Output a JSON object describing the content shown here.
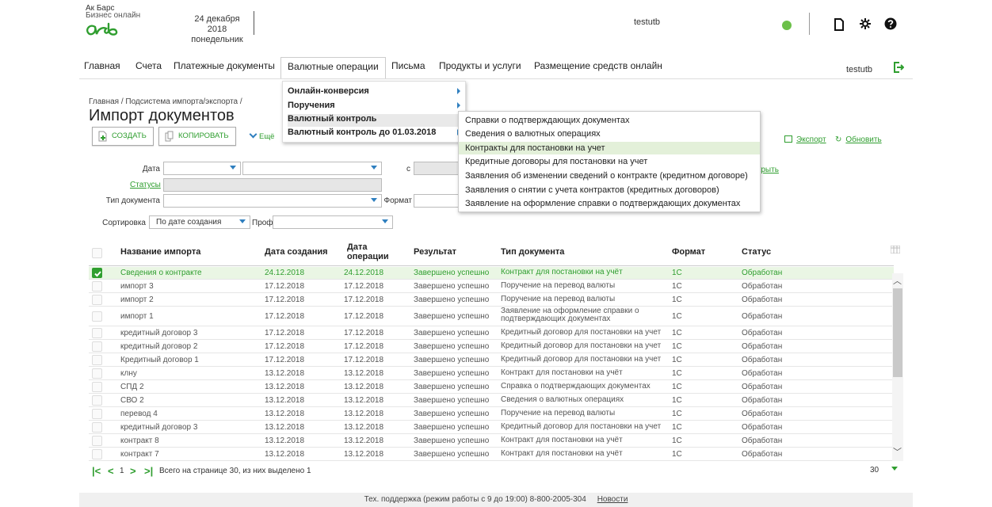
{
  "header": {
    "bank_line1": "Ак Барс",
    "bank_line2": "Бизнес онлайн",
    "date": "24 декабря 2018",
    "weekday": "понедельник",
    "user": "testutb",
    "status_color": "#6cc04a"
  },
  "nav": {
    "items": [
      "Главная",
      "Счета",
      "Платежные документы",
      "Валютные операции",
      "Письма",
      "Продукты и услуги",
      "Размещение средств онлайн"
    ],
    "user": "testutb"
  },
  "page": {
    "breadcrumb": "Главная / Подсистема импорта/экспорта /",
    "title": "Импорт документов",
    "create_label": "СОЗДАТЬ",
    "copy_label": "КОПИРОВАТЬ",
    "more_label": "Ещё",
    "export_label": "Экспорт",
    "refresh_label": "Обновить",
    "hide_label": "крыть"
  },
  "filters": {
    "date_label": "Дата",
    "from_label": "с",
    "statuses_label": "Статусы",
    "doc_type_label": "Тип документа",
    "format_label": "Формат",
    "sort_label": "Сортировка",
    "sort_value": "По дате создания",
    "profile_label": "Профиль"
  },
  "menu": {
    "items": [
      "Онлайн-конверсия",
      "Поручения",
      "Валютный контроль",
      "Валютный контроль до 01.03.2018"
    ],
    "submenu": [
      "Справки о подтверждающих документах",
      "Сведения о валютных операциях",
      "Контракты для постановки на учет",
      "Кредитные договоры для постановки на учет",
      "Заявления об изменении сведений о контракте (кредитном договоре)",
      "Заявления о снятии с учета контрактов (кредитных договоров)",
      "Заявление на оформление справки о подтверждающих документах"
    ]
  },
  "table": {
    "headers": {
      "name": "Название импорта",
      "created": "Дата создания",
      "op_date_1": "Дата",
      "op_date_2": "операции",
      "result": "Результат",
      "doc_type": "Тип документа",
      "format": "Формат",
      "status": "Статус"
    },
    "rows": [
      {
        "name": "Сведения о контракте",
        "created": "24.12.2018",
        "op": "24.12.2018",
        "result": "Завершено успешно",
        "type": "Контракт для постановки на учёт",
        "type2": "",
        "format": "1С",
        "status": "Обработан"
      },
      {
        "name": "импорт 3",
        "created": "17.12.2018",
        "op": "17.12.2018",
        "result": "Завершено успешно",
        "type": "Поручение на перевод валюты",
        "type2": "",
        "format": "1С",
        "status": "Обработан"
      },
      {
        "name": "импорт 2",
        "created": "17.12.2018",
        "op": "17.12.2018",
        "result": "Завершено успешно",
        "type": "Поручение на перевод валюты",
        "type2": "",
        "format": "1С",
        "status": "Обработан"
      },
      {
        "name": "импорт 1",
        "created": "17.12.2018",
        "op": "17.12.2018",
        "result": "Завершено успешно",
        "type": "Заявление на оформление справки о",
        "type2": "подтверждающих документах",
        "format": "1С",
        "status": "Обработан"
      },
      {
        "name": "кредитный договор 3",
        "created": "17.12.2018",
        "op": "17.12.2018",
        "result": "Завершено успешно",
        "type": "Кредитный договор для постановки на учет",
        "type2": "",
        "format": "1С",
        "status": "Обработан"
      },
      {
        "name": "кредитный договор 2",
        "created": "17.12.2018",
        "op": "17.12.2018",
        "result": "Завершено успешно",
        "type": "Кредитный договор для постановки на учет",
        "type2": "",
        "format": "1С",
        "status": "Обработан"
      },
      {
        "name": "Кредитный договор 1",
        "created": "17.12.2018",
        "op": "17.12.2018",
        "result": "Завершено успешно",
        "type": "Кредитный договор для постановки на учет",
        "type2": "",
        "format": "1С",
        "status": "Обработан"
      },
      {
        "name": "клну",
        "created": "13.12.2018",
        "op": "13.12.2018",
        "result": "Завершено успешно",
        "type": "Контракт для постановки на учёт",
        "type2": "",
        "format": "1С",
        "status": "Обработан"
      },
      {
        "name": "СПД 2",
        "created": "13.12.2018",
        "op": "13.12.2018",
        "result": "Завершено успешно",
        "type": "Справка о подтверждающих документах",
        "type2": "",
        "format": "1С",
        "status": "Обработан"
      },
      {
        "name": "СВО 2",
        "created": "13.12.2018",
        "op": "13.12.2018",
        "result": "Завершено успешно",
        "type": "Сведения о валютных операциях",
        "type2": "",
        "format": "1С",
        "status": "Обработан"
      },
      {
        "name": "перевод 4",
        "created": "13.12.2018",
        "op": "13.12.2018",
        "result": "Завершено успешно",
        "type": "Поручение на перевод валюты",
        "type2": "",
        "format": "1С",
        "status": "Обработан"
      },
      {
        "name": "кредитный договор 3",
        "created": "13.12.2018",
        "op": "13.12.2018",
        "result": "Завершено успешно",
        "type": "Кредитный договор для постановки на учет",
        "type2": "",
        "format": "1С",
        "status": "Обработан"
      },
      {
        "name": "контракт 8",
        "created": "13.12.2018",
        "op": "13.12.2018",
        "result": "Завершено успешно",
        "type": "Контракт для постановки на учёт",
        "type2": "",
        "format": "1С",
        "status": "Обработан"
      },
      {
        "name": "контракт 7",
        "created": "13.12.2018",
        "op": "13.12.2018",
        "result": "Завершено успешно",
        "type": "Контракт для постановки на учёт",
        "type2": "",
        "format": "1С",
        "status": "Обработан"
      }
    ]
  },
  "pager": {
    "page": "1",
    "summary": "Всего на странице 30, из них выделено 1",
    "page_size": "30"
  },
  "footer": {
    "support": "Тех. поддержка (режим работы с 9 до 19:00) 8-800-2005-304",
    "news": "Новости"
  }
}
